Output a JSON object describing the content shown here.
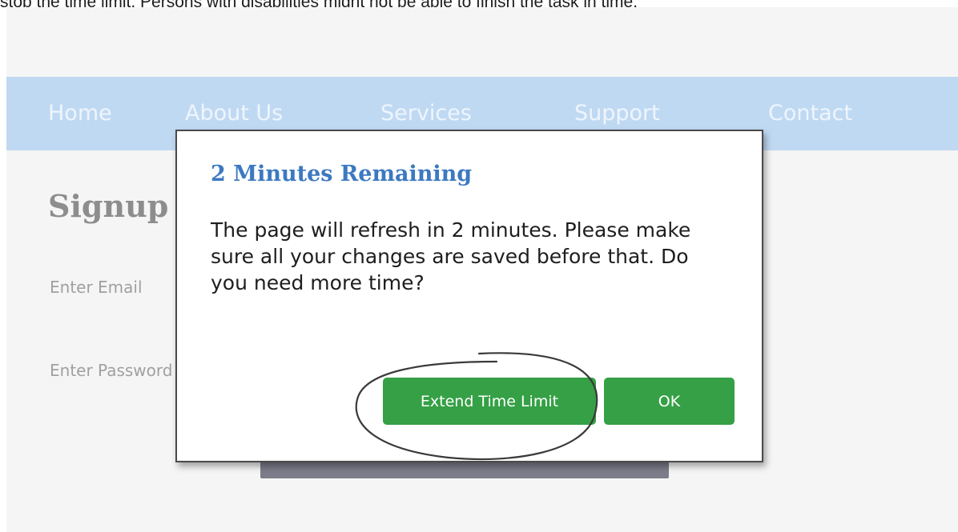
{
  "caption": {
    "text": "stop the time limit. Persons with disabilities might not be able to finish the task in time."
  },
  "navbar": {
    "items": [
      {
        "label": "Home"
      },
      {
        "label": "About Us"
      },
      {
        "label": "Services"
      },
      {
        "label": "Support"
      },
      {
        "label": "Contact"
      }
    ]
  },
  "form": {
    "title": "Signup",
    "email_label": "Enter Email",
    "password_label": "Enter Password"
  },
  "dialog": {
    "title": "2 Minutes Remaining",
    "message": "The page will refresh in 2 minutes. Please make sure all your changes are saved before that. Do you need more time?",
    "extend_label": "Extend Time Limit",
    "ok_label": "OK"
  },
  "colors": {
    "navbar": "#c0d9f3",
    "dialog_title": "#3c79c0",
    "button": "#35a045"
  }
}
